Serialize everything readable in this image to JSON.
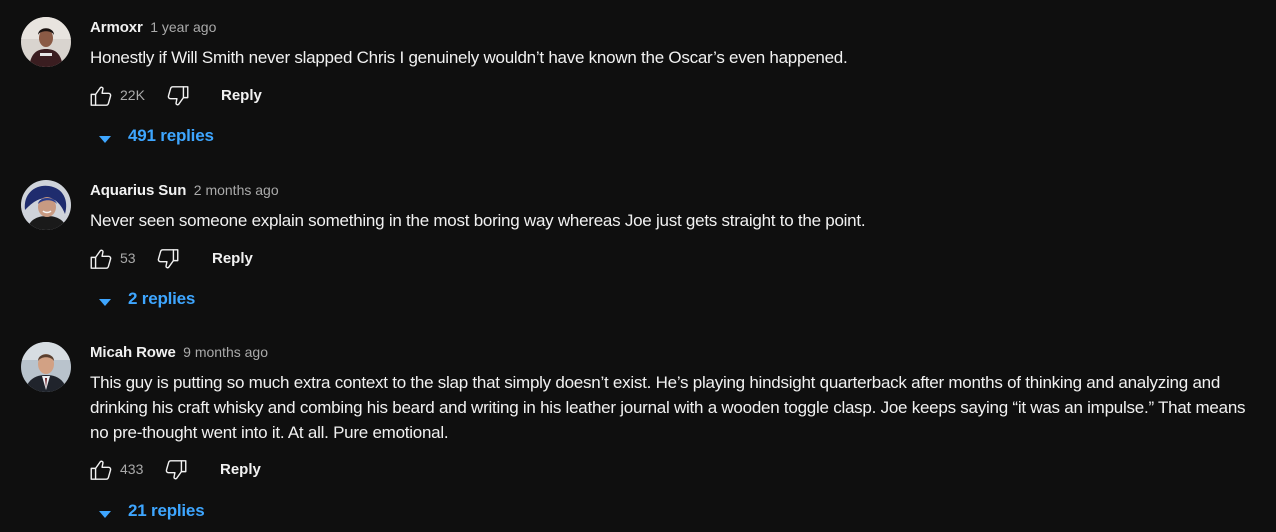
{
  "comments": [
    {
      "author": "Armoxr",
      "timestamp": "1 year ago",
      "text": "Honestly if Will Smith never slapped Chris I genuinely wouldn’t have known the Oscar’s even happened.",
      "likes": "22K",
      "reply_label": "Reply",
      "replies_label": "491 replies",
      "avatar_icon": "avatar-person-dark-shirt"
    },
    {
      "author": "Aquarius Sun",
      "timestamp": "2 months ago",
      "text": "Never seen someone explain something in the most boring way whereas Joe just gets straight to the point.",
      "likes": "53",
      "reply_label": "Reply",
      "replies_label": "2 replies",
      "avatar_icon": "avatar-blue-hair-person"
    },
    {
      "author": "Micah Rowe",
      "timestamp": "9 months ago",
      "text": "This guy is putting so much extra context to the slap that simply doesn’t exist. He’s playing hindsight quarterback after months of thinking and analyzing and drinking his craft whisky and combing his beard and writing in his leather journal with a wooden toggle clasp. Joe keeps saying “it was an impulse.” That means no pre-thought went into it. At all. Pure emotional.",
      "likes": "433",
      "reply_label": "Reply",
      "replies_label": "21 replies",
      "avatar_icon": "avatar-man-in-suit"
    }
  ],
  "colors": {
    "background": "#0f0f0f",
    "text_primary": "#f1f1f1",
    "text_secondary": "#aaaaaa",
    "link_blue": "#3ea6ff"
  },
  "icons": {
    "like": "thumbs-up-icon",
    "dislike": "thumbs-down-icon",
    "expand": "caret-down-icon"
  }
}
